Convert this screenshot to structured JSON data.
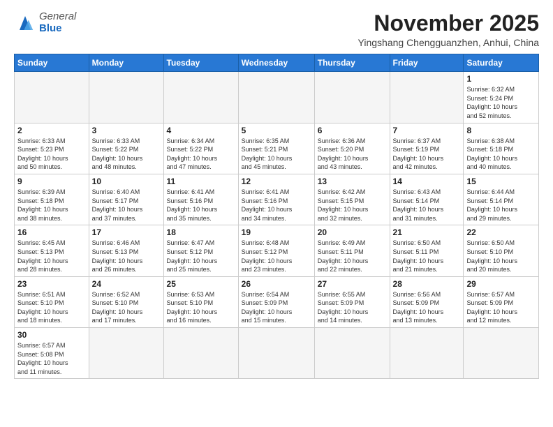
{
  "logo": {
    "general": "General",
    "blue": "Blue"
  },
  "title": "November 2025",
  "subtitle": "Yingshang Chengguanzhen, Anhui, China",
  "weekdays": [
    "Sunday",
    "Monday",
    "Tuesday",
    "Wednesday",
    "Thursday",
    "Friday",
    "Saturday"
  ],
  "weeks": [
    [
      {
        "day": "",
        "info": ""
      },
      {
        "day": "",
        "info": ""
      },
      {
        "day": "",
        "info": ""
      },
      {
        "day": "",
        "info": ""
      },
      {
        "day": "",
        "info": ""
      },
      {
        "day": "",
        "info": ""
      },
      {
        "day": "1",
        "info": "Sunrise: 6:32 AM\nSunset: 5:24 PM\nDaylight: 10 hours\nand 52 minutes."
      }
    ],
    [
      {
        "day": "2",
        "info": "Sunrise: 6:33 AM\nSunset: 5:23 PM\nDaylight: 10 hours\nand 50 minutes."
      },
      {
        "day": "3",
        "info": "Sunrise: 6:33 AM\nSunset: 5:22 PM\nDaylight: 10 hours\nand 48 minutes."
      },
      {
        "day": "4",
        "info": "Sunrise: 6:34 AM\nSunset: 5:22 PM\nDaylight: 10 hours\nand 47 minutes."
      },
      {
        "day": "5",
        "info": "Sunrise: 6:35 AM\nSunset: 5:21 PM\nDaylight: 10 hours\nand 45 minutes."
      },
      {
        "day": "6",
        "info": "Sunrise: 6:36 AM\nSunset: 5:20 PM\nDaylight: 10 hours\nand 43 minutes."
      },
      {
        "day": "7",
        "info": "Sunrise: 6:37 AM\nSunset: 5:19 PM\nDaylight: 10 hours\nand 42 minutes."
      },
      {
        "day": "8",
        "info": "Sunrise: 6:38 AM\nSunset: 5:18 PM\nDaylight: 10 hours\nand 40 minutes."
      }
    ],
    [
      {
        "day": "9",
        "info": "Sunrise: 6:39 AM\nSunset: 5:18 PM\nDaylight: 10 hours\nand 38 minutes."
      },
      {
        "day": "10",
        "info": "Sunrise: 6:40 AM\nSunset: 5:17 PM\nDaylight: 10 hours\nand 37 minutes."
      },
      {
        "day": "11",
        "info": "Sunrise: 6:41 AM\nSunset: 5:16 PM\nDaylight: 10 hours\nand 35 minutes."
      },
      {
        "day": "12",
        "info": "Sunrise: 6:41 AM\nSunset: 5:16 PM\nDaylight: 10 hours\nand 34 minutes."
      },
      {
        "day": "13",
        "info": "Sunrise: 6:42 AM\nSunset: 5:15 PM\nDaylight: 10 hours\nand 32 minutes."
      },
      {
        "day": "14",
        "info": "Sunrise: 6:43 AM\nSunset: 5:14 PM\nDaylight: 10 hours\nand 31 minutes."
      },
      {
        "day": "15",
        "info": "Sunrise: 6:44 AM\nSunset: 5:14 PM\nDaylight: 10 hours\nand 29 minutes."
      }
    ],
    [
      {
        "day": "16",
        "info": "Sunrise: 6:45 AM\nSunset: 5:13 PM\nDaylight: 10 hours\nand 28 minutes."
      },
      {
        "day": "17",
        "info": "Sunrise: 6:46 AM\nSunset: 5:13 PM\nDaylight: 10 hours\nand 26 minutes."
      },
      {
        "day": "18",
        "info": "Sunrise: 6:47 AM\nSunset: 5:12 PM\nDaylight: 10 hours\nand 25 minutes."
      },
      {
        "day": "19",
        "info": "Sunrise: 6:48 AM\nSunset: 5:12 PM\nDaylight: 10 hours\nand 23 minutes."
      },
      {
        "day": "20",
        "info": "Sunrise: 6:49 AM\nSunset: 5:11 PM\nDaylight: 10 hours\nand 22 minutes."
      },
      {
        "day": "21",
        "info": "Sunrise: 6:50 AM\nSunset: 5:11 PM\nDaylight: 10 hours\nand 21 minutes."
      },
      {
        "day": "22",
        "info": "Sunrise: 6:50 AM\nSunset: 5:10 PM\nDaylight: 10 hours\nand 20 minutes."
      }
    ],
    [
      {
        "day": "23",
        "info": "Sunrise: 6:51 AM\nSunset: 5:10 PM\nDaylight: 10 hours\nand 18 minutes."
      },
      {
        "day": "24",
        "info": "Sunrise: 6:52 AM\nSunset: 5:10 PM\nDaylight: 10 hours\nand 17 minutes."
      },
      {
        "day": "25",
        "info": "Sunrise: 6:53 AM\nSunset: 5:10 PM\nDaylight: 10 hours\nand 16 minutes."
      },
      {
        "day": "26",
        "info": "Sunrise: 6:54 AM\nSunset: 5:09 PM\nDaylight: 10 hours\nand 15 minutes."
      },
      {
        "day": "27",
        "info": "Sunrise: 6:55 AM\nSunset: 5:09 PM\nDaylight: 10 hours\nand 14 minutes."
      },
      {
        "day": "28",
        "info": "Sunrise: 6:56 AM\nSunset: 5:09 PM\nDaylight: 10 hours\nand 13 minutes."
      },
      {
        "day": "29",
        "info": "Sunrise: 6:57 AM\nSunset: 5:09 PM\nDaylight: 10 hours\nand 12 minutes."
      }
    ],
    [
      {
        "day": "30",
        "info": "Sunrise: 6:57 AM\nSunset: 5:08 PM\nDaylight: 10 hours\nand 11 minutes."
      },
      {
        "day": "",
        "info": ""
      },
      {
        "day": "",
        "info": ""
      },
      {
        "day": "",
        "info": ""
      },
      {
        "day": "",
        "info": ""
      },
      {
        "day": "",
        "info": ""
      },
      {
        "day": "",
        "info": ""
      }
    ]
  ]
}
